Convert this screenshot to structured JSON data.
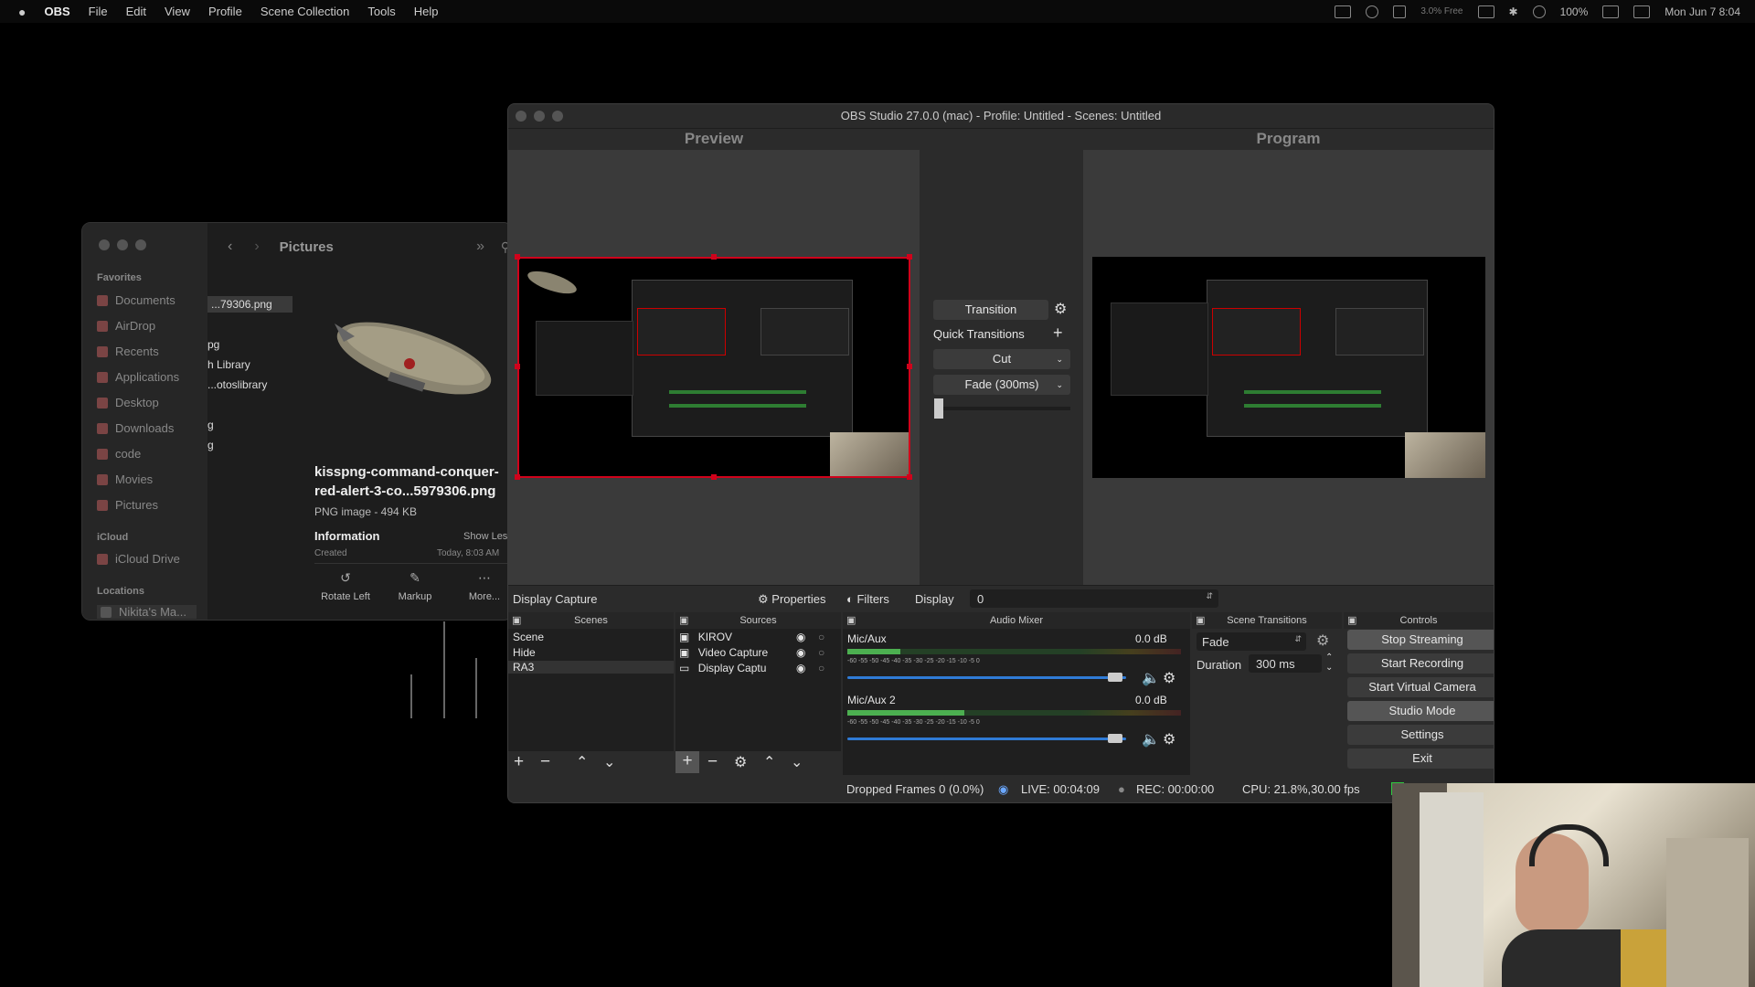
{
  "menubar": {
    "app": "OBS",
    "items": [
      "File",
      "Edit",
      "View",
      "Profile",
      "Scene Collection",
      "Tools",
      "Help"
    ],
    "memory": "3.0% Free",
    "battery": "100%",
    "clock": "Mon Jun 7  8:04"
  },
  "finder": {
    "title": "Pictures",
    "sidebar": {
      "favorites_heading": "Favorites",
      "favorites": [
        "Documents",
        "AirDrop",
        "Recents",
        "Applications",
        "Desktop",
        "Downloads",
        "code",
        "Movies",
        "Pictures"
      ],
      "icloud_heading": "iCloud",
      "icloud": [
        "iCloud Drive"
      ],
      "locations_heading": "Locations",
      "locations": [
        "Nikita's Ma..."
      ]
    },
    "files": [
      "...79306.png",
      "pg",
      "h Library",
      "...otoslibrary",
      "g",
      "g"
    ],
    "preview": {
      "filename": "kisspng-command-conquer-red-alert-3-co...5979306.png",
      "filename_line1": "kisspng-command-conquer-",
      "filename_line2": "red-alert-3-co...5979306.png",
      "type": "PNG image - 494 KB",
      "info_heading": "Information",
      "show_less": "Show Less",
      "created_label": "Created",
      "created_value": "Today, 8:03 AM"
    },
    "actions": [
      "Rotate Left",
      "Markup",
      "More..."
    ]
  },
  "obs": {
    "title": "OBS Studio 27.0.0 (mac) - Profile: Untitled - Scenes: Untitled",
    "preview_label": "Preview",
    "program_label": "Program",
    "transition": {
      "button": "Transition",
      "quick_label": "Quick Transitions",
      "cut": "Cut",
      "fade": "Fade (300ms)"
    },
    "source_bar": {
      "source_name": "Display Capture",
      "properties": "Properties",
      "filters": "Filters",
      "display_label": "Display",
      "display_value": "0"
    },
    "docks": {
      "scenes_title": "Scenes",
      "sources_title": "Sources",
      "mixer_title": "Audio Mixer",
      "transitions_title": "Scene Transitions",
      "controls_title": "Controls"
    },
    "scenes": [
      "Scene",
      "Hide",
      "RA3"
    ],
    "selected_scene": "RA3",
    "sources": [
      {
        "name": "KIROV",
        "icon": "image-icon"
      },
      {
        "name": "Video Capture",
        "icon": "camera-icon"
      },
      {
        "name": "Display Captu",
        "icon": "monitor-icon"
      }
    ],
    "mixer": [
      {
        "name": "Mic/Aux",
        "db": "0.0 dB",
        "level": 0.16,
        "volume": 0.96
      },
      {
        "name": "Mic/Aux 2",
        "db": "0.0 dB",
        "level": 0.35,
        "volume": 0.96
      }
    ],
    "meter_ticks": "-60  -55  -50  -45  -40  -35  -30  -25  -20  -15  -10  -5  0",
    "scene_transitions": {
      "selected": "Fade",
      "duration_label": "Duration",
      "duration_value": "300 ms"
    },
    "controls": [
      "Stop Streaming",
      "Start Recording",
      "Start Virtual Camera",
      "Studio Mode",
      "Settings",
      "Exit"
    ],
    "status": {
      "dropped": "Dropped Frames 0 (0.0%)",
      "live": "LIVE: 00:04:09",
      "rec": "REC: 00:00:00",
      "cpu": "CPU: 21.8%,30.00 fps"
    }
  },
  "colors": {
    "selection_red": "#d0021b",
    "fader_blue": "#2f7bd6",
    "meter_green": "#2e7d32"
  }
}
